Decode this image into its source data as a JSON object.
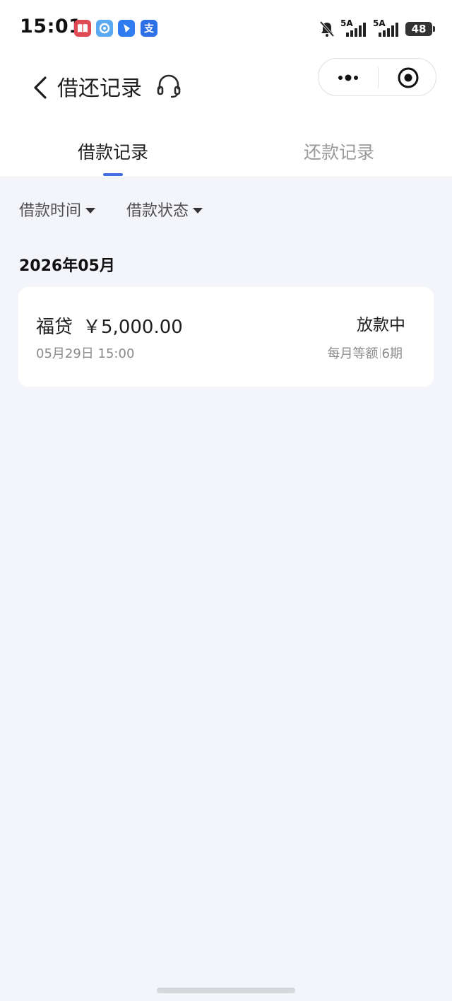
{
  "status_bar": {
    "time": "15:01",
    "notification_icons": [
      "book-app-icon",
      "browser-app-icon",
      "messenger-app-icon",
      "alipay-app-icon"
    ],
    "alipay_glyph": "支",
    "network_1": "5A",
    "network_2": "5A",
    "battery": "48"
  },
  "nav": {
    "title": "借还记录"
  },
  "tabs": [
    {
      "label": "借款记录",
      "active": true
    },
    {
      "label": "还款记录",
      "active": false
    }
  ],
  "filters": {
    "time_label": "借款时间",
    "status_label": "借款状态"
  },
  "section": {
    "month": "2026年05月"
  },
  "loan": {
    "product": "福贷",
    "amount": "￥5,000.00",
    "status": "放款中",
    "datetime": "05月29日 15:00",
    "repay_method": "每月等额",
    "periods": "6期"
  },
  "colors": {
    "accent": "#3f6fe0",
    "background": "#f4f5fa",
    "card": "#ffffff"
  }
}
